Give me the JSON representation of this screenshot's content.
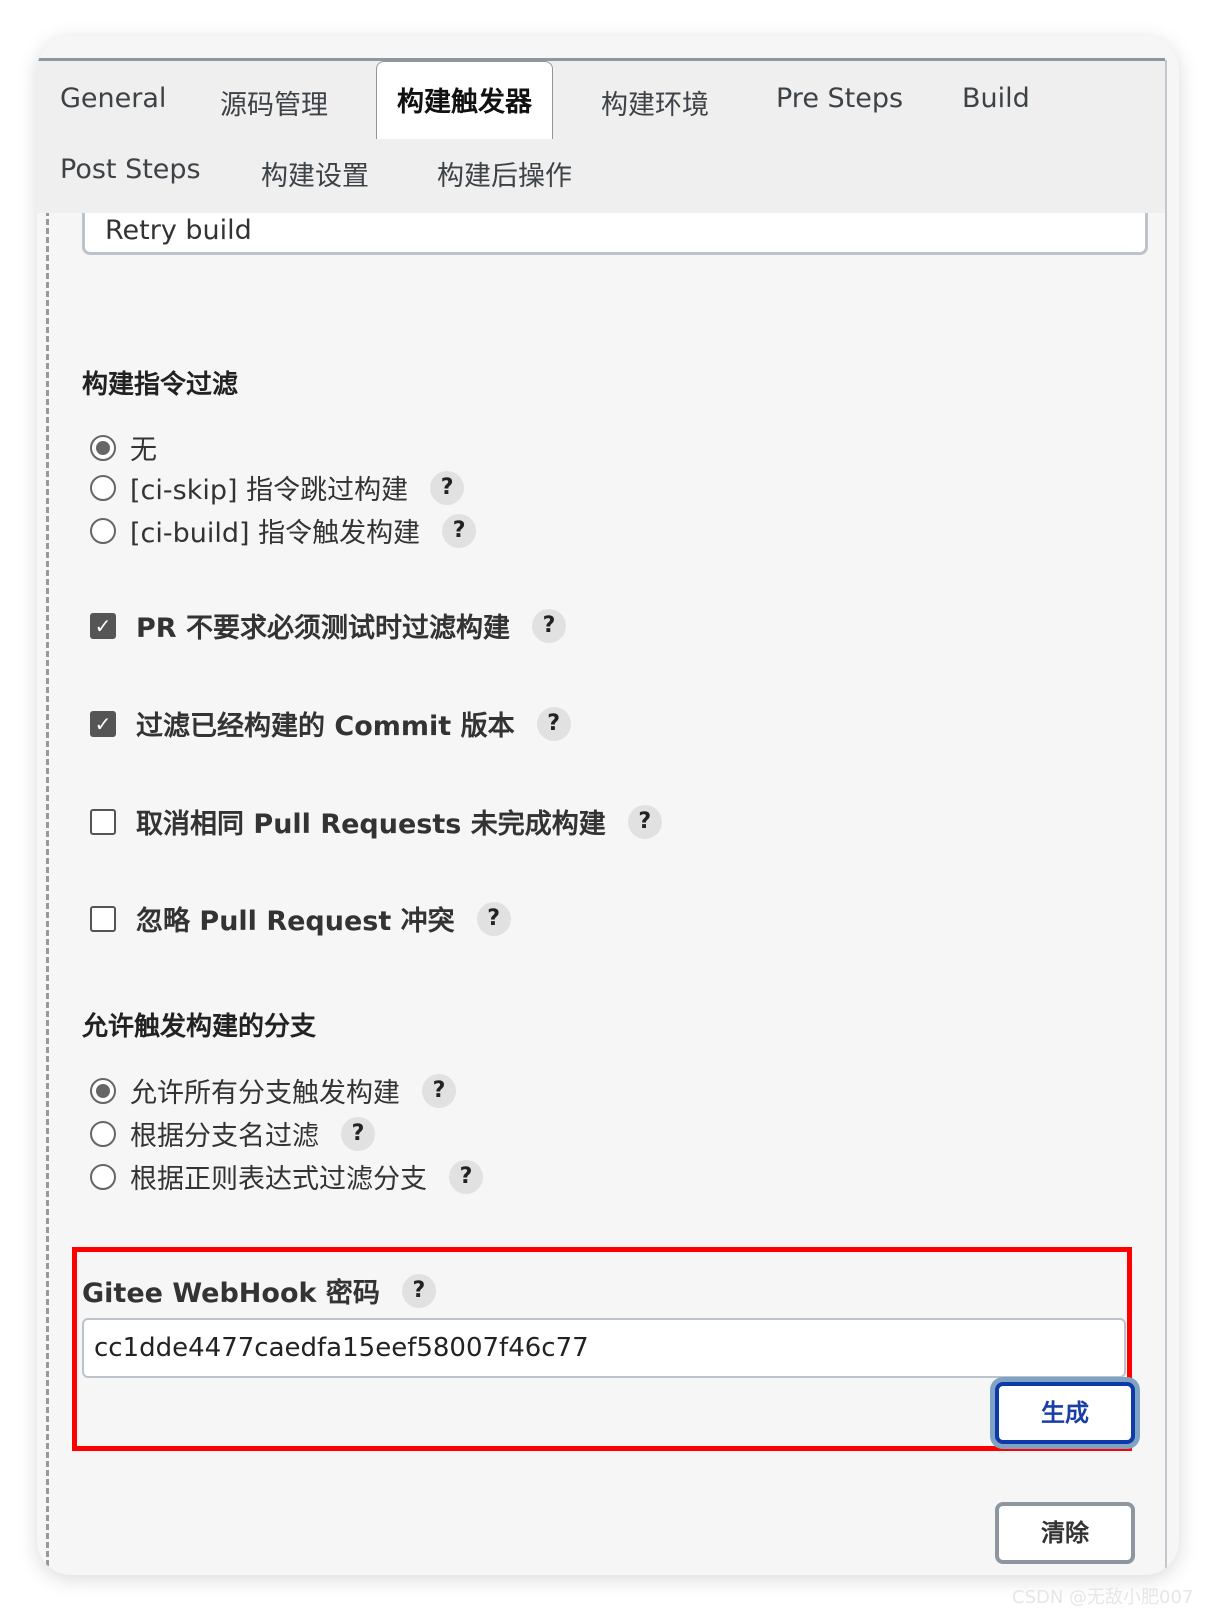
{
  "tabs": [
    "General",
    "源码管理",
    "构建触发器",
    "构建环境",
    "Pre Steps",
    "Build",
    "Post Steps",
    "构建设置",
    "构建后操作"
  ],
  "active_tab": "构建触发器",
  "retry_field": "Retry build",
  "filter": {
    "title": "构建指令过滤",
    "options": [
      "无",
      "[ci-skip] 指令跳过构建",
      "[ci-build] 指令触发构建"
    ],
    "selected": "无"
  },
  "checkboxes": [
    {
      "label": "PR 不要求必须测试时过滤构建",
      "checked": true
    },
    {
      "label": "过滤已经构建的 Commit 版本",
      "checked": true
    },
    {
      "label": "取消相同 Pull Requests 未完成构建",
      "checked": false
    },
    {
      "label": "忽略 Pull Request 冲突",
      "checked": false
    }
  ],
  "branch": {
    "title": "允许触发构建的分支",
    "options": [
      "允许所有分支触发构建",
      "根据分支名过滤",
      "根据正则表达式过滤分支"
    ],
    "selected": "允许所有分支触发构建"
  },
  "webhook": {
    "label": "Gitee WebHook 密码",
    "value": "cc1dde4477caedfa15eef58007f46c77",
    "generate": "生成"
  },
  "clear": "清除",
  "help": "?",
  "check": "✓",
  "watermark": "CSDN @无敌小肥007",
  "colors": {
    "highlight": "#ff0000",
    "primary": "#0d3aa8"
  }
}
